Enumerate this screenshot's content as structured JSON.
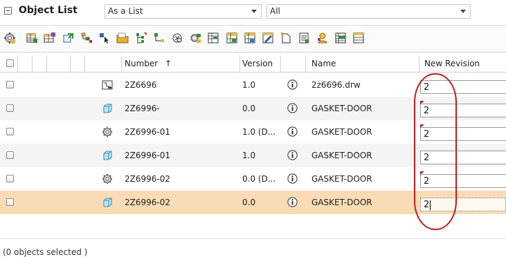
{
  "header": {
    "title": "Object List",
    "view_select": {
      "value": "As a List"
    },
    "filter_select": {
      "value": "All"
    }
  },
  "toolbar": {
    "icons": [
      "settings-icon",
      "table-icon",
      "table-edit-icon",
      "navigate-icon",
      "structure-icon",
      "select-icon",
      "folder-icon",
      "tree-icon",
      "branch-icon",
      "cut-icon",
      "config-icon",
      "table-view-icon",
      "table-add-icon",
      "table-replace-icon",
      "edit-icon",
      "new-object-icon",
      "list-icon",
      "user-icon",
      "spreadsheet-icon",
      "more-icon"
    ]
  },
  "columns": {
    "number": "Number",
    "sort_indicator": "↑",
    "version": "Version",
    "name": "Name",
    "new_revision": "New Revision"
  },
  "rows": [
    {
      "type": "drawing",
      "number": "2Z6696",
      "version": "1.0",
      "name": "2z6696.drw",
      "new_revision": "2",
      "flag": false,
      "editing": false
    },
    {
      "type": "part",
      "number": "2Z6996-",
      "version": "0.0",
      "name": "GASKET-DOOR",
      "new_revision": "2",
      "flag": true,
      "editing": false
    },
    {
      "type": "assembly",
      "number": "2Z6996-01",
      "version": "1.0 (D...",
      "name": "GASKET-DOOR",
      "new_revision": "2",
      "flag": true,
      "editing": false
    },
    {
      "type": "part",
      "number": "2Z6996-01",
      "version": "1.0",
      "name": "GASKET-DOOR",
      "new_revision": "2",
      "flag": false,
      "editing": false
    },
    {
      "type": "assembly",
      "number": "2Z6996-02",
      "version": "0.0 (D...",
      "name": "GASKET-DOOR",
      "new_revision": "2",
      "flag": true,
      "editing": false
    },
    {
      "type": "part",
      "number": "2Z6996-02",
      "version": "0.0",
      "name": "GASKET-DOOR",
      "new_revision": "2",
      "flag": false,
      "editing": true
    }
  ],
  "status": {
    "text": "(0 objects selected )"
  },
  "colors": {
    "selected_row": "#f9dcb5",
    "annotation": "#c41a1a",
    "flag": "#c02020"
  }
}
